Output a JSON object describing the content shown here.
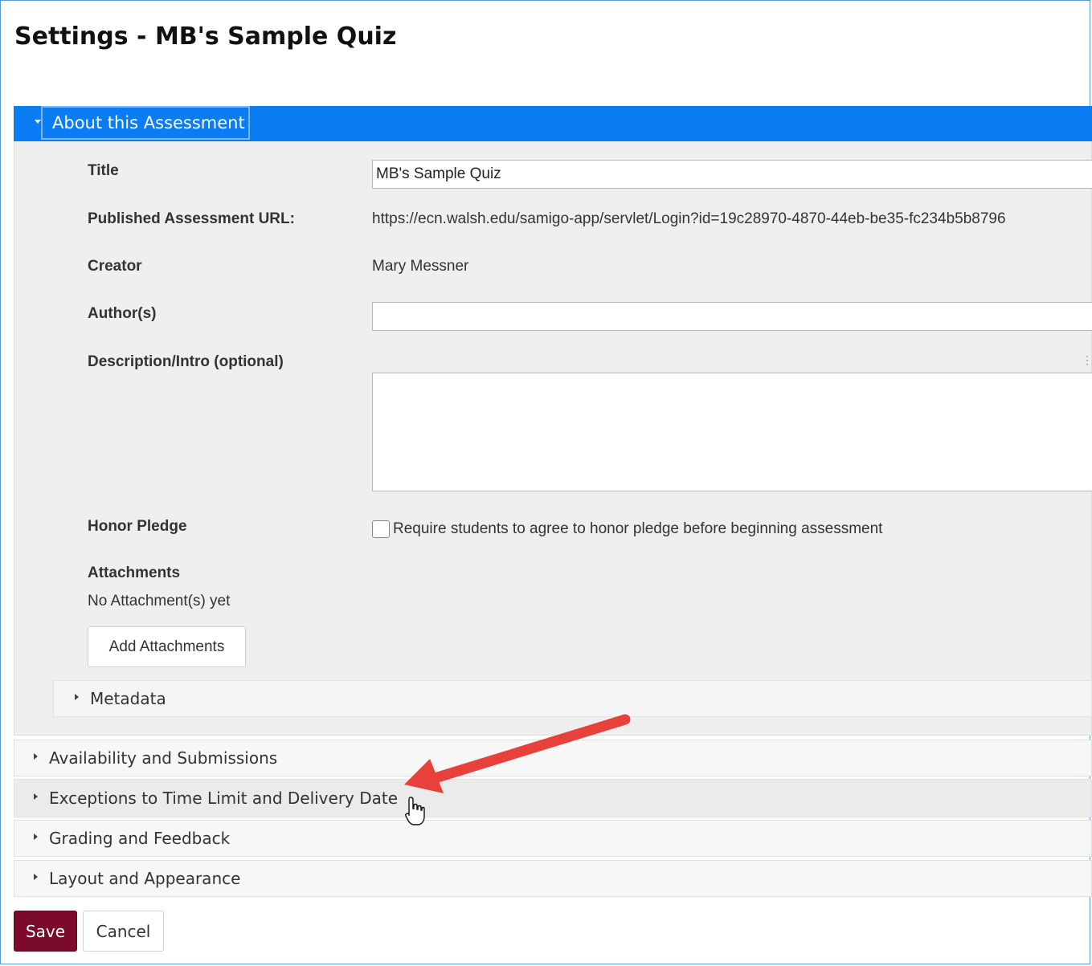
{
  "page_title": "Settings - MB's Sample Quiz",
  "about_panel": {
    "header": "About this Assessment",
    "title_label": "Title",
    "title_value": "MB's Sample Quiz",
    "url_label": "Published Assessment URL:",
    "url_value": "https://ecn.walsh.edu/samigo-app/servlet/Login?id=19c28970-4870-44eb-be35-fc234b5b8796",
    "creator_label": "Creator",
    "creator_value": "Mary Messner",
    "authors_label": "Author(s)",
    "authors_value": "",
    "description_label": "Description/Intro (optional)",
    "honor_label": "Honor Pledge",
    "honor_checkbox_label": "Require students to agree to honor pledge before beginning assessment",
    "honor_checked": false,
    "attachments_label": "Attachments",
    "attachments_status": "No Attachment(s) yet",
    "add_attachments_button": "Add Attachments",
    "metadata_label": "Metadata"
  },
  "sections": {
    "availability": "Availability and Submissions",
    "exceptions": "Exceptions to Time Limit and Delivery Date",
    "grading": "Grading and Feedback",
    "layout": "Layout and Appearance"
  },
  "buttons": {
    "save": "Save",
    "cancel": "Cancel"
  },
  "colors": {
    "accent_header": "#0a7cf4",
    "save_button": "#7c0a2b",
    "annotation_arrow": "#e8413c"
  },
  "icons": {
    "expanded_caret": "caret-down-icon",
    "collapsed_caret": "caret-right-icon",
    "cursor": "hand-pointer-icon",
    "annotation": "red-arrow-annotation"
  }
}
